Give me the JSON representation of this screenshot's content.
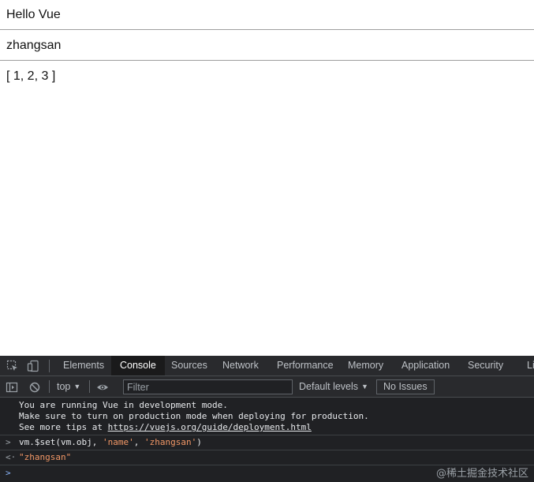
{
  "page": {
    "greeting": "Hello Vue",
    "name": "zhangsan",
    "array": "[ 1, 2, 3 ]"
  },
  "devtools": {
    "tabs": [
      "Elements",
      "Console",
      "Sources",
      "Network",
      "Performance",
      "Memory",
      "Application",
      "Security",
      "Li"
    ],
    "active_tab": "Console",
    "toolbar": {
      "context": "top",
      "filter_placeholder": "Filter",
      "levels": "Default levels",
      "issues": "No Issues"
    },
    "icons": [
      "inspect-element-icon",
      "device-toggle-icon",
      "sidebar-toggle-icon",
      "clear-console-icon",
      "eye-icon"
    ],
    "log": {
      "line1": "You are running Vue in development mode.",
      "line2": "Make sure to turn on production mode when deploying for production.",
      "line3_prefix": "See more tips at ",
      "line3_link": "https://vuejs.org/guide/deployment.html"
    },
    "command": {
      "prompt": ">",
      "part1": "vm.$set(vm.obj, ",
      "arg1": "'name'",
      "sep": ", ",
      "arg2": "'zhangsan'",
      "end": ")"
    },
    "result": {
      "prompt": "<·",
      "value": "\"zhangsan\""
    },
    "input_prompt": ">"
  },
  "watermark": "@稀土掘金技术社区",
  "colors": {
    "devtools_bg": "#202124",
    "string": "#f29766",
    "prompt_blue": "#8ab4f8"
  }
}
